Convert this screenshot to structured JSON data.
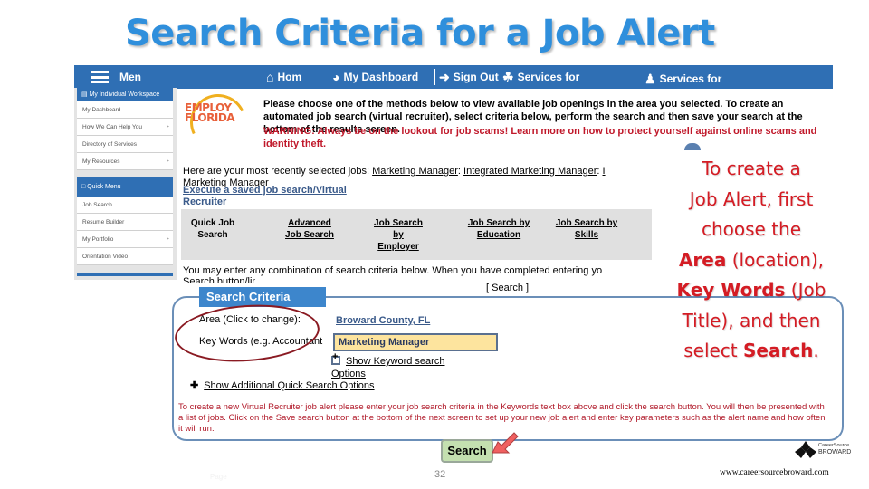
{
  "slide": {
    "title": "Search Criteria for a Job Alert",
    "page_number": "32",
    "footer_url": "www.careersourcebroward.com",
    "footer_logo": {
      "line1": "CareerSource",
      "line2": "BROWARD"
    },
    "faint_text": "Page"
  },
  "navbar": {
    "menu": "Men",
    "home": "Hom",
    "dashboard": "My Dashboard",
    "sign_out": "Sign Out",
    "services1": "Services for",
    "services2": "Services for"
  },
  "sidebar": {
    "section1_header": "My Individual Workspace",
    "section1_items": [
      {
        "label": "My Dashboard",
        "arrow": false
      },
      {
        "label": "How We Can Help You",
        "arrow": true
      },
      {
        "label": "Directory of Services",
        "arrow": false
      },
      {
        "label": "My Resources",
        "arrow": true
      }
    ],
    "section2_header": "Quick Menu",
    "section2_items": [
      {
        "label": "Job Search",
        "arrow": false
      },
      {
        "label": "Resume Builder",
        "arrow": false
      },
      {
        "label": "My Portfolio",
        "arrow": true
      },
      {
        "label": "Orientation Video",
        "arrow": false
      }
    ]
  },
  "logo": {
    "line1": "EMPLOY",
    "line2": "FLORIDA"
  },
  "main": {
    "intro": "Please choose one of the methods below to view available job openings in the area you selected. To create an automated job search (virtual recruiter), select criteria below, perform the search and then save your search at the bottom of the results screen.",
    "warning": "WARNING: Always be on the lookout for job scams! Learn more on how to protect yourself against online scams and identity theft.",
    "recent_prefix": "Here are your most recently selected jobs:",
    "recent_jobs": [
      "Marketing Manager",
      "Integrated Marketing Manager",
      "I"
    ],
    "recent_overflow": "Marketing Manager",
    "execute_saved": "Execute a saved job search/Virtual Recruiter",
    "methods": [
      {
        "label": "Quick Job Search",
        "link": false
      },
      {
        "label": "Advanced Job Search",
        "link": true
      },
      {
        "label": "Job Search by Employer",
        "link": true
      },
      {
        "label": "Job Search by Education",
        "link": true
      },
      {
        "label": "Job Search by Skills",
        "link": true
      }
    ],
    "criteria_intro": "You may enter any combination of search criteria below. When you have completed entering yo",
    "criteria_intro2": "Search button/link.",
    "search_link": "Search",
    "criteria_tab": "Search Criteria",
    "area_label": "Area (Click to change):",
    "area_value": "Broward County, FL",
    "keywords_label": "Key Words (e.g. Accountant",
    "keywords_value": "Marketing Manager",
    "keyword_options": "Show Keyword search",
    "keyword_options2": "Options",
    "additional_options": "Show Additional Quick Search Options",
    "vr_note": "To create a new Virtual Recruiter job alert please enter your job search criteria in the Keywords text box above and click the search button. You will then be presented with a list of jobs.  Click on the Save search button at the bottom of the next screen to set up your new job alert and enter key parameters such as the alert name and how often it will run.",
    "search_button": "Search"
  },
  "callout": {
    "line1": "To create a",
    "line2": "Job Alert, first",
    "line3": "choose the",
    "area_bold": "Area",
    "area_rest": " (location),",
    "kw_bold": "Key Words",
    "kw_rest": " (Job",
    "line6": "Title), and then",
    "select": "select ",
    "search_bold": "Search",
    "period": "."
  },
  "colors": {
    "title_blue": "#2f8fdc",
    "nav_blue": "#2f6fb4",
    "warning_red": "#c0182a",
    "callout_red": "#d41c24",
    "keyword_fill": "#fde49e",
    "search_button_fill": "#c4e0b0"
  }
}
